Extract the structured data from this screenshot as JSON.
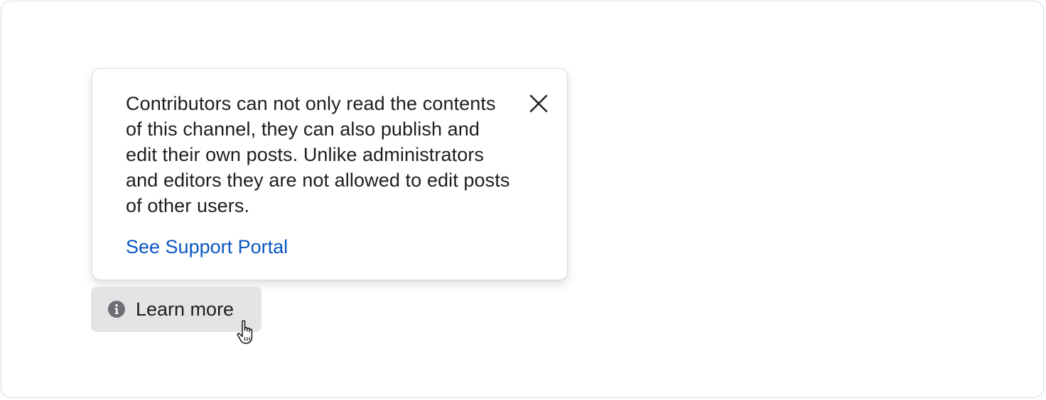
{
  "popover": {
    "description": "Contributors can not only read the contents of this channel, they can also publish and edit their own posts. Unlike administrators and editors they are not allowed to edit posts of other users.",
    "link_label": "See Support Portal",
    "close_icon": "close-icon"
  },
  "trigger": {
    "label": "Learn more",
    "icon": "info-icon"
  },
  "colors": {
    "link": "#0a57c2",
    "text": "#1d1d1f",
    "trigger_bg": "#e4e4e7",
    "icon": "#6e6e73"
  }
}
